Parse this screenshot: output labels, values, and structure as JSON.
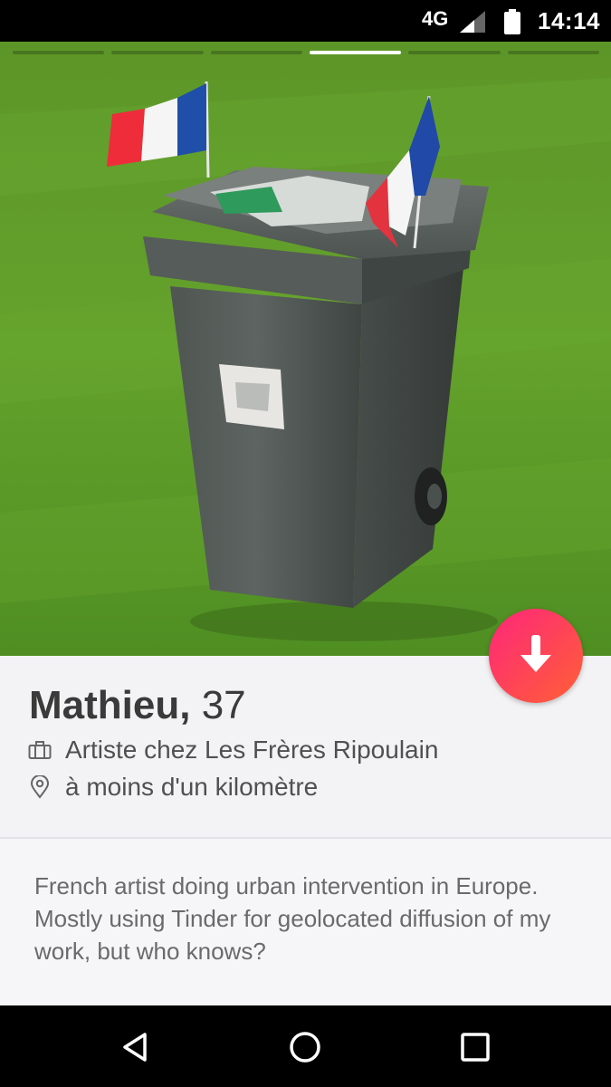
{
  "status_bar": {
    "network": "4G",
    "time": "14:14"
  },
  "photo": {
    "segments": 6,
    "active_segment": 4
  },
  "profile": {
    "name": "Mathieu,",
    "age": "37",
    "job": "Artiste chez Les Frères Ripoulain",
    "distance": "à moins d'un kilomètre",
    "bio": "French artist doing urban intervention in Europe. Mostly using Tinder for geolocated diffusion of my work, but who knows?"
  },
  "icons": {
    "job": "briefcase-icon",
    "location": "location-pin-icon",
    "expand": "arrow-down-icon",
    "nav": [
      "back-icon",
      "home-icon",
      "recents-icon"
    ]
  },
  "colors": {
    "accent_start": "#fd267a",
    "accent_end": "#ff6036"
  }
}
